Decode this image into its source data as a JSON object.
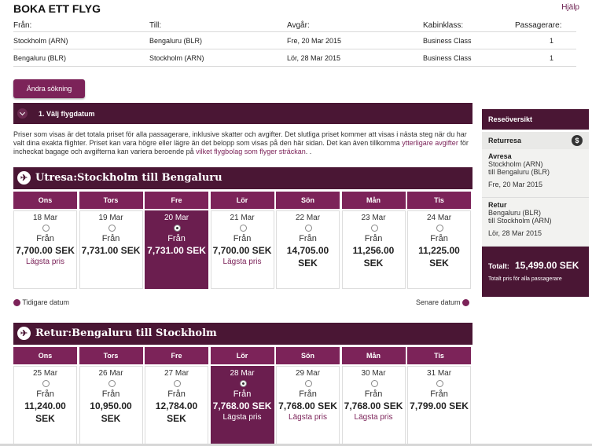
{
  "page": {
    "title": "BOKA ETT FLYG",
    "help": "Hjälp"
  },
  "summary": {
    "headers": [
      "Från:",
      "Till:",
      "Avgår:",
      "Kabinklass:",
      "Passagerare:"
    ],
    "rows": [
      [
        "Stockholm (ARN)",
        "Bengaluru (BLR)",
        "Fre, 20 Mar 2015",
        "Business Class",
        "1"
      ],
      [
        "Bengaluru (BLR)",
        "Stockholm (ARN)",
        "Lör, 28 Mar 2015",
        "Business Class",
        "1"
      ]
    ]
  },
  "change_search": "Ändra sökning",
  "step": "1. Välj flygdatum",
  "info": {
    "text": "Priser som visas är det totala priset för alla passagerare, inklusive skatter och avgifter. Det slutliga priset kommer att visas i nästa steg när du har valt dina exakta flighter. Priset kan vara högre eller lägre än det belopp som visas på den här sidan. Det kan även tillkomma ",
    "link1": "ytterligare avgifter",
    "mid": " för incheckat bagage och avgifterna kan variera beroende på ",
    "link2": "vilket flygbolag som flyger sträckan",
    "end": ". ."
  },
  "outbound": {
    "title": "Utresa:Stockholm till Bengaluru",
    "days": [
      {
        "day": "Ons",
        "date": "18 Mar",
        "from": "Från",
        "price": "7,700.00 SEK",
        "price2": "",
        "lowest": "Lägsta pris",
        "selected": false
      },
      {
        "day": "Tors",
        "date": "19 Mar",
        "from": "Från",
        "price": "7,731.00 SEK",
        "price2": "",
        "lowest": "",
        "selected": false
      },
      {
        "day": "Fre",
        "date": "20 Mar",
        "from": "Från",
        "price": "7,731.00 SEK",
        "price2": "",
        "lowest": "",
        "selected": true
      },
      {
        "day": "Lör",
        "date": "21 Mar",
        "from": "Från",
        "price": "7,700.00 SEK",
        "price2": "",
        "lowest": "Lägsta pris",
        "selected": false
      },
      {
        "day": "Sön",
        "date": "22 Mar",
        "from": "Från",
        "price": "14,705.00",
        "price2": "SEK",
        "lowest": "",
        "selected": false
      },
      {
        "day": "Mån",
        "date": "23 Mar",
        "from": "Från",
        "price": "11,256.00",
        "price2": "SEK",
        "lowest": "",
        "selected": false
      },
      {
        "day": "Tis",
        "date": "24 Mar",
        "from": "Från",
        "price": "11,225.00",
        "price2": "SEK",
        "lowest": "",
        "selected": false
      }
    ],
    "prev": "Tidigare datum",
    "next": "Senare datum"
  },
  "return": {
    "title": "Retur:Bengaluru till Stockholm",
    "days": [
      {
        "day": "Ons",
        "date": "25 Mar",
        "from": "Från",
        "price": "11,240.00",
        "price2": "SEK",
        "lowest": "",
        "selected": false
      },
      {
        "day": "Tors",
        "date": "26 Mar",
        "from": "Från",
        "price": "10,950.00",
        "price2": "SEK",
        "lowest": "",
        "selected": false
      },
      {
        "day": "Fre",
        "date": "27 Mar",
        "from": "Från",
        "price": "12,784.00",
        "price2": "SEK",
        "lowest": "",
        "selected": false
      },
      {
        "day": "Lör",
        "date": "28 Mar",
        "from": "Från",
        "price": "7,768.00 SEK",
        "price2": "",
        "lowest": "Lägsta pris",
        "selected": true
      },
      {
        "day": "Sön",
        "date": "29 Mar",
        "from": "Från",
        "price": "7,768.00 SEK",
        "price2": "",
        "lowest": "Lägsta pris",
        "selected": false
      },
      {
        "day": "Mån",
        "date": "30 Mar",
        "from": "Från",
        "price": "7,768.00 SEK",
        "price2": "",
        "lowest": "Lägsta pris",
        "selected": false
      },
      {
        "day": "Tis",
        "date": "31 Mar",
        "from": "Från",
        "price": "7,799.00 SEK",
        "price2": "",
        "lowest": "",
        "selected": false
      }
    ]
  },
  "sidebar": {
    "title": "Reseöversikt",
    "trip": "Returresa",
    "currency_icon": "$",
    "legs": [
      {
        "label": "Avresa",
        "from": "Stockholm (ARN)",
        "to": "till Bengaluru (BLR)",
        "date": "Fre, 20 Mar 2015"
      },
      {
        "label": "Retur",
        "from": "Bengaluru (BLR)",
        "to": "till Stockholm (ARN)",
        "date": "Lör, 28 Mar 2015"
      }
    ],
    "total_label": "Totalt:",
    "total_value": "15,499.00 SEK",
    "total_note": "Totalt pris för alla passagerare"
  }
}
